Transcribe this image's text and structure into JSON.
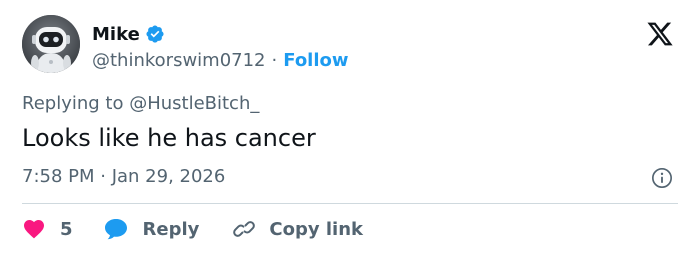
{
  "author": {
    "display_name": "Mike",
    "handle": "@thinkorswim0712",
    "separator": "·",
    "follow_label": "Follow",
    "verified": true,
    "avatar_icon": "robot-avatar"
  },
  "platform": {
    "logo_icon": "x-logo-icon"
  },
  "tweet": {
    "replying_to": "Replying to @HustleBitch_",
    "text": "Looks like he has cancer",
    "timestamp": "7:58 PM · Jan 29, 2026"
  },
  "actions": {
    "like_count": "5",
    "reply_label": "Reply",
    "copy_link_label": "Copy link"
  },
  "colors": {
    "accent": "#1d9bf0",
    "like": "#f91880",
    "text_primary": "#0f1419",
    "text_secondary": "#536471",
    "divider": "#cfd9de"
  }
}
